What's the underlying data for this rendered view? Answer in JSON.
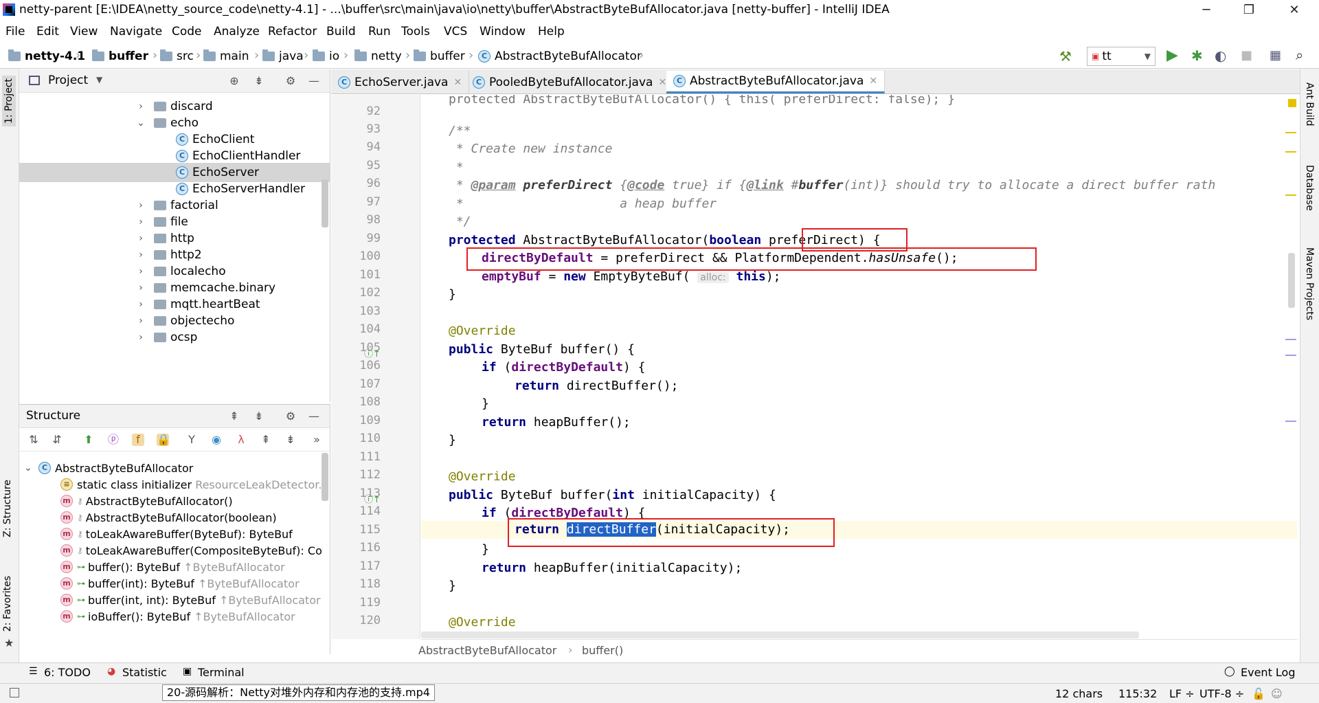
{
  "window": {
    "title": "netty-parent [E:\\IDEA\\netty_source_code\\netty-4.1] - ...\\buffer\\src\\main\\java\\io\\netty\\buffer\\AbstractByteBufAllocator.java [netty-buffer] - IntelliJ IDEA",
    "minimize": "─",
    "restore": "❐",
    "close": "✕"
  },
  "menu": [
    "File",
    "Edit",
    "View",
    "Navigate",
    "Code",
    "Analyze",
    "Refactor",
    "Build",
    "Run",
    "Tools",
    "VCS",
    "Window",
    "Help"
  ],
  "navbar": {
    "crumbs": [
      "netty-4.1",
      "buffer",
      "src",
      "main",
      "java",
      "io",
      "netty",
      "buffer",
      "AbstractByteBufAllocator"
    ],
    "run_config": "tt"
  },
  "left_stripe": {
    "project": "1: Project",
    "structure": "Z: Structure",
    "favorites": "2: Favorites"
  },
  "right_stripe": {
    "ant": "Ant Build",
    "database": "Database",
    "maven": "Maven Projects"
  },
  "project": {
    "title": "Project",
    "items": [
      {
        "label": "discard",
        "type": "folder",
        "expanded": false
      },
      {
        "label": "echo",
        "type": "folder",
        "expanded": true
      },
      {
        "label": "EchoClient",
        "type": "class"
      },
      {
        "label": "EchoClientHandler",
        "type": "class"
      },
      {
        "label": "EchoServer",
        "type": "class"
      },
      {
        "label": "EchoServerHandler",
        "type": "class"
      },
      {
        "label": "factorial",
        "type": "folder",
        "expanded": false
      },
      {
        "label": "file",
        "type": "folder",
        "expanded": false
      },
      {
        "label": "http",
        "type": "folder",
        "expanded": false
      },
      {
        "label": "http2",
        "type": "folder",
        "expanded": false
      },
      {
        "label": "localecho",
        "type": "folder",
        "expanded": false
      },
      {
        "label": "memcache.binary",
        "type": "folder",
        "expanded": false
      },
      {
        "label": "mqtt.heartBeat",
        "type": "folder",
        "expanded": false
      },
      {
        "label": "objectecho",
        "type": "folder",
        "expanded": false
      },
      {
        "label": "ocsp",
        "type": "folder",
        "expanded": false
      }
    ]
  },
  "structure": {
    "title": "Structure",
    "root": "AbstractByteBufAllocator",
    "items": [
      {
        "label": "static class initializer",
        "hint": "ResourceLeakDetector..."
      },
      {
        "label": "AbstractByteBufAllocator()",
        "hint": ""
      },
      {
        "label": "AbstractByteBufAllocator(boolean)",
        "hint": ""
      },
      {
        "label": "toLeakAwareBuffer(ByteBuf): ByteBuf",
        "hint": ""
      },
      {
        "label": "toLeakAwareBuffer(CompositeByteBuf): Co",
        "hint": ""
      },
      {
        "label": "buffer(): ByteBuf",
        "hint": "↑ByteBufAllocator"
      },
      {
        "label": "buffer(int): ByteBuf",
        "hint": "↑ByteBufAllocator"
      },
      {
        "label": "buffer(int, int): ByteBuf",
        "hint": "↑ByteBufAllocator"
      },
      {
        "label": "ioBuffer(): ByteBuf",
        "hint": "↑ByteBufAllocator"
      }
    ]
  },
  "editor": {
    "tabs": [
      {
        "label": "EchoServer.java",
        "active": false
      },
      {
        "label": "PooledByteBufAllocator.java",
        "active": false
      },
      {
        "label": "AbstractByteBufAllocator.java",
        "active": true
      }
    ],
    "line_numbers": [
      "92",
      "93",
      "94",
      "95",
      "96",
      "97",
      "98",
      "99",
      "100",
      "101",
      "102",
      "103",
      "104",
      "105",
      "106",
      "107",
      "108",
      "109",
      "110",
      "111",
      "112",
      "113",
      "114",
      "115",
      "116",
      "117",
      "118",
      "119",
      "120"
    ],
    "code": {
      "l92": "protected AbstractByteBufAllocator() { this( preferDirect: false); }",
      "l93": "/**",
      "l94": " * Create new instance",
      "l95": " *",
      "l96_a": " * ",
      "l96_param": "@param",
      "l96_b": " ",
      "l96_name": "preferDirect",
      "l96_c": " {",
      "l96_code": "@code",
      "l96_d": " true} if {",
      "l96_link": "@link",
      "l96_e": " #",
      "l96_buf": "buffer",
      "l96_f": "(int)} should try to allocate a direct buffer rath",
      "l97": " *                     a heap buffer",
      "l98": " */",
      "l99_kw": "protected",
      "l99_a": " AbstractByteBufAllocator(",
      "l99_kw2": "boolean",
      "l99_b": " preferDirect) {",
      "l100_fld": "directByDefault",
      "l100_a": " = preferDirect && PlatformDependent.",
      "l100_m": "hasUnsafe",
      "l100_b": "();",
      "l101_fld": "emptyBuf",
      "l101_a": " = ",
      "l101_kw": "new",
      "l101_b": " EmptyByteBuf( ",
      "l101_hint": "alloc:",
      "l101_c": " ",
      "l101_kw2": "this",
      "l101_d": ");",
      "l102": "}",
      "l104": "@Override",
      "l105_kw": "public",
      "l105_a": " ByteBuf buffer() {",
      "l106_kw": "if",
      "l106_a": " (",
      "l106_fld": "directByDefault",
      "l106_b": ") {",
      "l107_kw": "return",
      "l107_a": " directBuffer();",
      "l108": "}",
      "l109_kw": "return",
      "l109_a": " heapBuffer();",
      "l110": "}",
      "l112": "@Override",
      "l113_kw": "public",
      "l113_a": " ByteBuf buffer(",
      "l113_kw2": "int",
      "l113_b": " initialCapacity) {",
      "l114_kw": "if",
      "l114_a": " (",
      "l114_fld": "directByDefault",
      "l114_b": ") {",
      "l115_kw": "return",
      "l115_sel": "directBuffer",
      "l115_a": "(initialCapacity);",
      "l116": "}",
      "l117_kw": "return",
      "l117_a": " heapBuffer(initialCapacity);",
      "l118": "}",
      "l120": "@Override"
    },
    "breadcrumb": [
      "AbstractByteBufAllocator",
      "buffer()"
    ]
  },
  "toolwindows": {
    "todo": "6: TODO",
    "statistic": "Statistic",
    "terminal": "Terminal",
    "event_log": "Event Log"
  },
  "status": {
    "tooltip": "20-源码解析：Netty对堆外内存和内存池的支持.mp4",
    "chars": "12 chars",
    "position": "115:32",
    "line_sep": "LF ÷",
    "encoding": "UTF-8 ÷"
  },
  "colors": {
    "highlight_box": "#e02020",
    "selection": "#2163c6",
    "keyword": "#000080",
    "field": "#660e7a",
    "comment": "#808080",
    "annotation": "#808000"
  }
}
